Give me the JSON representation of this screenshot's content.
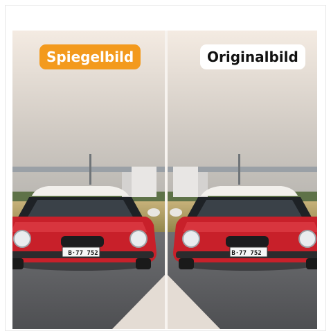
{
  "labels": {
    "left": "Spiegelbild",
    "right": "Originalbild"
  },
  "plates": {
    "left": "B·77 752",
    "right": "B·77 752"
  },
  "colors": {
    "left_pill_bg": "#f39a1d",
    "left_pill_text": "#ffffff",
    "right_pill_bg": "#ffffff",
    "right_pill_text": "#111111",
    "car_body": "#c8202a",
    "sky_top": "#efe7de",
    "sky_bottom": "#8c8f8f"
  }
}
